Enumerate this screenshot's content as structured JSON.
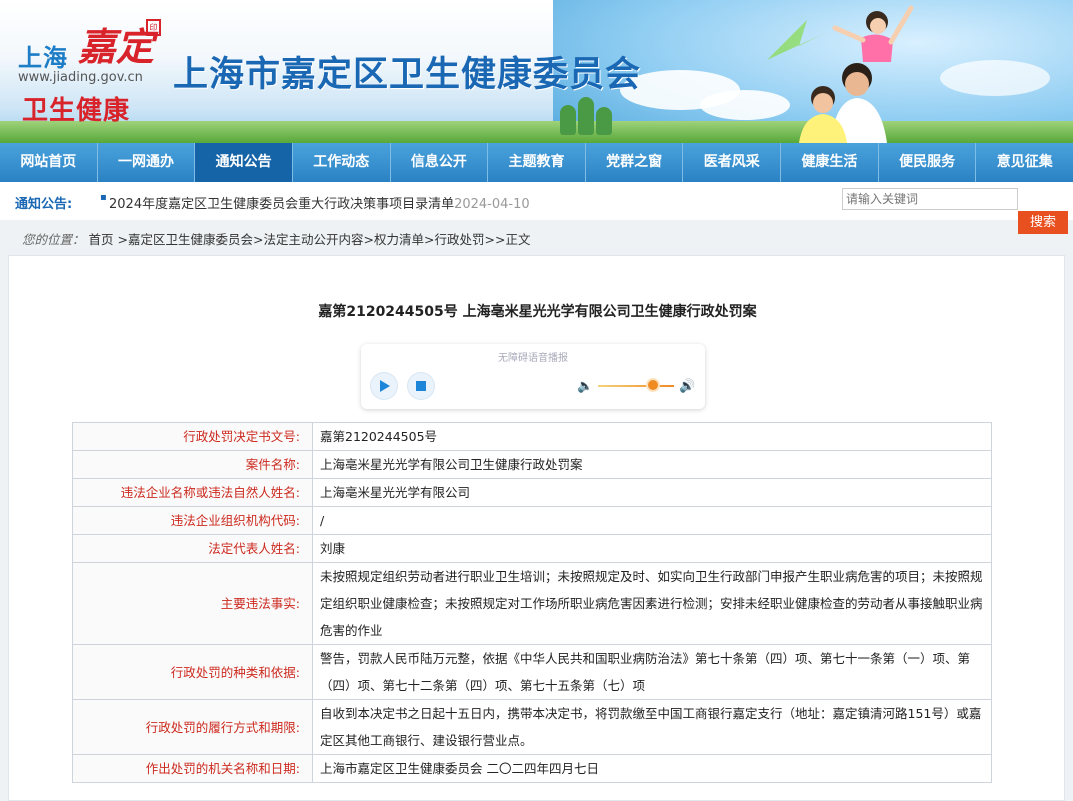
{
  "banner": {
    "logo_city": "上海",
    "logo_district": "嘉定",
    "logo_url": "www.jiading.gov.cn",
    "logo_sub": "卫生健康",
    "site_title": "上海市嘉定区卫生健康委员会"
  },
  "nav": {
    "items": [
      "网站首页",
      "一网通办",
      "通知公告",
      "工作动态",
      "信息公开",
      "主题教育",
      "党群之窗",
      "医者风采",
      "健康生活",
      "便民服务",
      "意见征集"
    ],
    "active_index": 2
  },
  "notice": {
    "label": "通知公告:",
    "text": "2024年度嘉定区卫生健康委员会重大行政决策事项目录清单",
    "date": "2024-04-10"
  },
  "search": {
    "placeholder": "请输入关键词",
    "button": "搜索"
  },
  "breadcrumb": {
    "label": "您的位置：",
    "items": [
      "首页",
      "嘉定区卫生健康委员会",
      "法定主动公开内容",
      "权力清单",
      "行政处罚",
      "正文"
    ],
    "separators": [
      " >",
      ">",
      ">",
      ">",
      ">>"
    ]
  },
  "article": {
    "title": "嘉第2120244505号 上海亳米星光光学有限公司卫生健康行政处罚案"
  },
  "player": {
    "caption": "无障碍语音播报",
    "volume_fraction": 0.72
  },
  "table": {
    "rows": [
      {
        "label": "行政处罚决定书文号:",
        "value": "嘉第2120244505号"
      },
      {
        "label": "案件名称:",
        "value": "上海亳米星光光学有限公司卫生健康行政处罚案"
      },
      {
        "label": "违法企业名称或违法自然人姓名:",
        "value": "上海亳米星光光学有限公司"
      },
      {
        "label": "违法企业组织机构代码:",
        "value": "/"
      },
      {
        "label": "法定代表人姓名:",
        "value": "刘康"
      },
      {
        "label": "主要违法事实:",
        "value": "未按照规定组织劳动者进行职业卫生培训；未按照规定及时、如实向卫生行政部门申报产生职业病危害的项目；未按照规定组织职业健康检查；未按照规定对工作场所职业病危害因素进行检测；安排未经职业健康检查的劳动者从事接触职业病危害的作业"
      },
      {
        "label": "行政处罚的种类和依据:",
        "value": "警告，罚款人民币陆万元整，依据《中华人民共和国职业病防治法》第七十条第（四）项、第七十一条第（一）项、第（四）项、第七十二条第（四）项、第七十五条第（七）项"
      },
      {
        "label": "行政处罚的履行方式和期限:",
        "value": "自收到本决定书之日起十五日内，携带本决定书，将罚款缴至中国工商银行嘉定支行（地址：嘉定镇清河路151号）或嘉定区其他工商银行、建设银行营业点。"
      },
      {
        "label": "作出处罚的机关名称和日期:",
        "value": "上海市嘉定区卫生健康委员会 二〇二四年四月七日"
      }
    ]
  },
  "colors": {
    "brand_blue": "#1a68b4",
    "nav_blue": "#2a82c4",
    "nav_active": "#1664a8",
    "logo_red": "#d8232a",
    "label_red": "#cc2a1f",
    "search_orange": "#e8501f"
  }
}
